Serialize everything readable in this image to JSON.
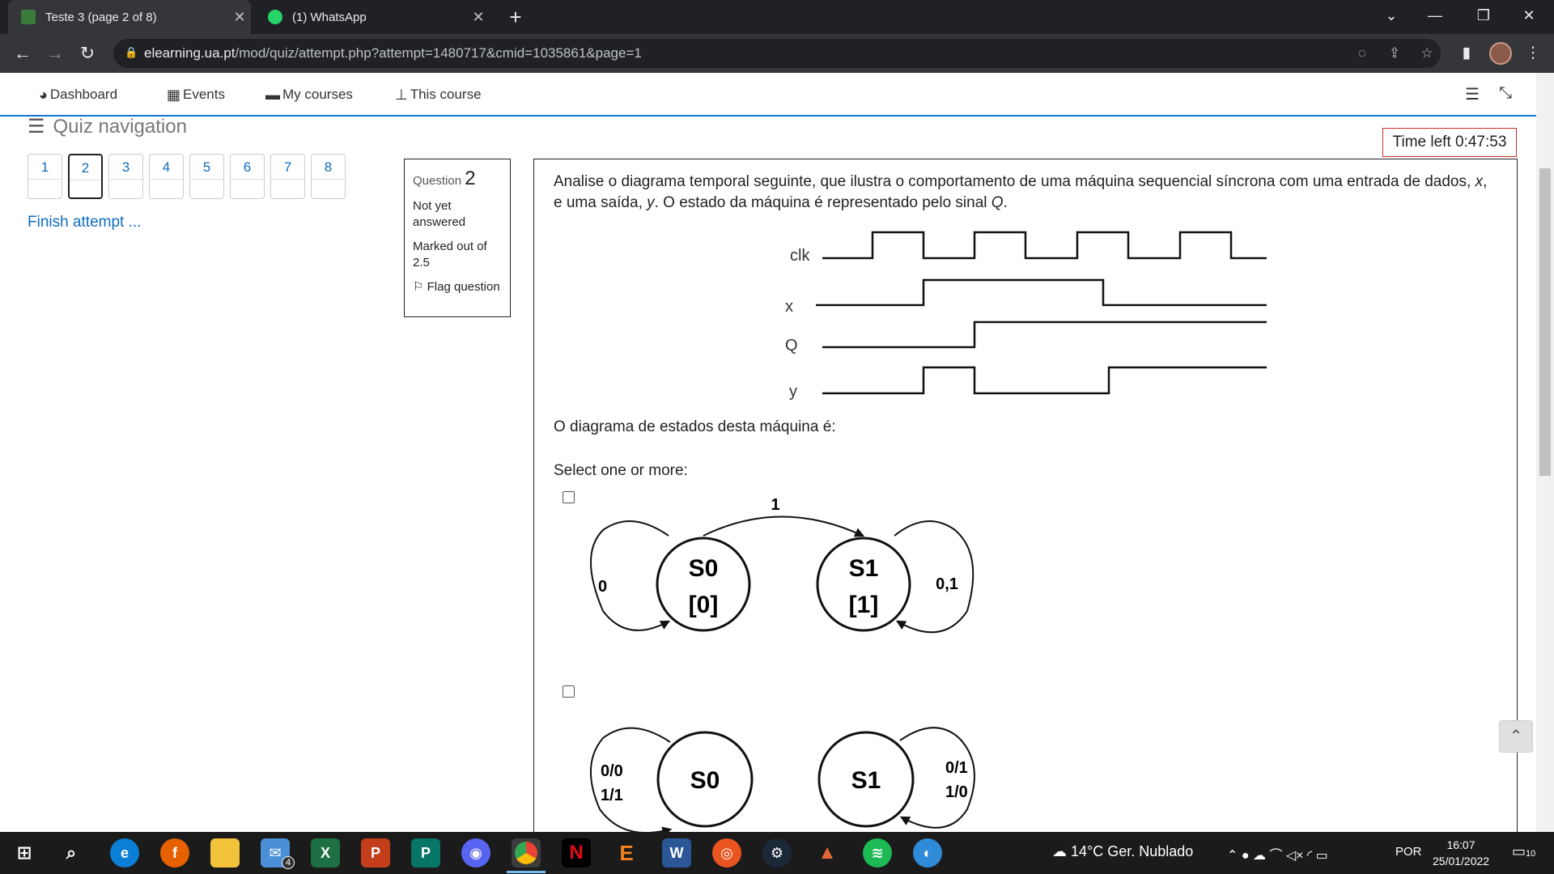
{
  "browser": {
    "tabs": [
      {
        "title": "Teste 3 (page 2 of 8)",
        "active": true
      },
      {
        "title": "(1) WhatsApp",
        "active": false
      }
    ],
    "url_host": "elearning.ua.pt",
    "url_path": "/mod/quiz/attempt.php?attempt=1480717&cmid=1035861&page=1"
  },
  "nav": {
    "dashboard": "Dashboard",
    "events": "Events",
    "my_courses": "My courses",
    "this_course": "This course"
  },
  "quiz_nav": {
    "title": "Quiz navigation",
    "questions": [
      "1",
      "2",
      "3",
      "4",
      "5",
      "6",
      "7",
      "8"
    ],
    "current": "2",
    "finish": "Finish attempt ..."
  },
  "question_info": {
    "label": "Question",
    "number": "2",
    "status": "Not yet answered",
    "marks": "Marked out of 2.5",
    "flag": "Flag question"
  },
  "timer": "Time left 0:47:53",
  "question": {
    "text_1": "Analise o diagrama temporal seguinte, que ilustra o comportamento de uma máquina sequencial síncrona com uma entrada de dados, ",
    "var_x": "x",
    "text_2": ", e uma saída, ",
    "var_y": "y",
    "text_3": ". O estado da máquina é representado pelo sinal ",
    "var_q": "Q",
    "text_4": ".",
    "prompt": "O diagrama de estados desta máquina é:",
    "select": "Select one or more:"
  },
  "timing_diagram": {
    "signals": [
      "clk",
      "x",
      "Q",
      "y"
    ]
  },
  "option_a": {
    "state0": "S0",
    "state0_out": "[0]",
    "state1": "S1",
    "state1_out": "[1]",
    "trans_0_1": "1",
    "loop0": "0",
    "loop1": "0,1"
  },
  "option_b": {
    "state0": "S0",
    "state1": "S1",
    "loop0_line1": "0/0",
    "loop0_line2": "1/1",
    "loop1_line1": "0/1",
    "loop1_line2": "1/0"
  },
  "taskbar": {
    "weather": "14°C  Ger. Nublado",
    "lang": "POR",
    "time": "16:07",
    "date": "25/01/2022",
    "mail_badge": "4",
    "notif_badge": "10"
  }
}
